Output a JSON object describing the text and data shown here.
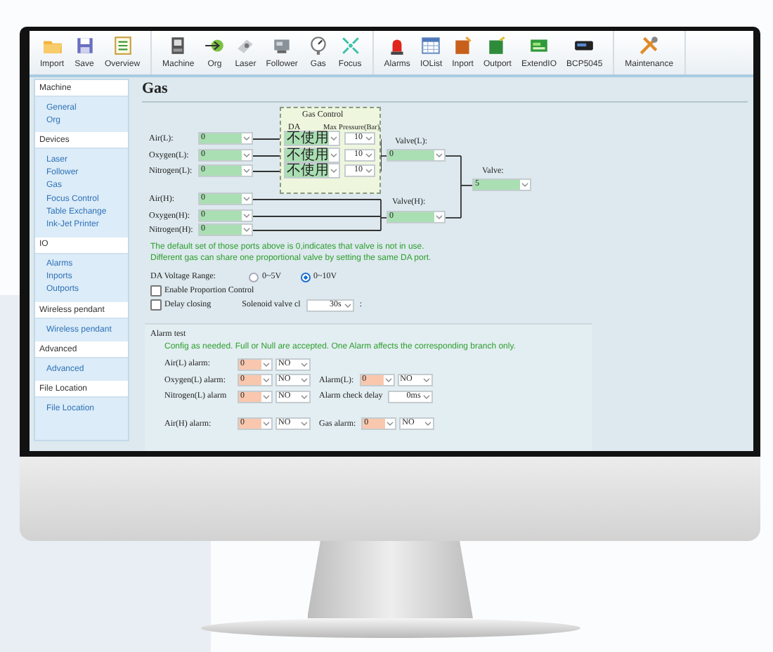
{
  "toolbar": {
    "groups": [
      [
        {
          "label": "Import",
          "kind": "folder"
        },
        {
          "label": "Save",
          "kind": "disk"
        },
        {
          "label": "Overview",
          "kind": "list"
        }
      ],
      [
        {
          "label": "Machine",
          "kind": "machine"
        },
        {
          "label": "Org",
          "kind": "origin"
        },
        {
          "label": "Laser",
          "kind": "laser"
        },
        {
          "label": "Follower",
          "kind": "follower"
        },
        {
          "label": "Gas",
          "kind": "gauge"
        },
        {
          "label": "Focus",
          "kind": "focus"
        }
      ],
      [
        {
          "label": "Alarms",
          "kind": "alarm"
        },
        {
          "label": "IOList",
          "kind": "table"
        },
        {
          "label": "Inport",
          "kind": "inport"
        },
        {
          "label": "Outport",
          "kind": "outport"
        },
        {
          "label": "ExtendIO",
          "kind": "board"
        },
        {
          "label": "BCP5045",
          "kind": "display"
        }
      ],
      [
        {
          "label": "Maintenance",
          "kind": "tools"
        }
      ]
    ]
  },
  "sidebar": {
    "groups": [
      {
        "title": "Machine",
        "items": [
          "General",
          "Org"
        ]
      },
      {
        "title": "Devices",
        "items": [
          "Laser",
          "Follower",
          "Gas",
          "Focus Control",
          "Table Exchange",
          "Ink-Jet Printer"
        ]
      },
      {
        "title": "IO",
        "items": [
          "Alarms",
          "Inports",
          "Outports"
        ]
      },
      {
        "title": "Wireless pendant",
        "items": [
          "Wireless pendant"
        ]
      },
      {
        "title": "Advanced",
        "items": [
          "Advanced"
        ]
      },
      {
        "title": "File Location",
        "items": [
          "File Location"
        ]
      }
    ]
  },
  "page": {
    "title": "Gas",
    "gas_control": {
      "title": "Gas Control",
      "da_header": "DA",
      "pressure_header": "Max Pressure(Bar)"
    },
    "low_gases": [
      {
        "label": "Air(L):",
        "port": "0",
        "da": "不使用",
        "pressure": "10"
      },
      {
        "label": "Oxygen(L):",
        "port": "0",
        "da": "不使用",
        "pressure": "10"
      },
      {
        "label": "Nitrogen(L):",
        "port": "0",
        "da": "不使用",
        "pressure": "10"
      }
    ],
    "high_gases": [
      {
        "label": "Air(H):",
        "port": "0"
      },
      {
        "label": "Oxygen(H):",
        "port": "0"
      },
      {
        "label": "Nitrogen(H):",
        "port": "0"
      }
    ],
    "valve_low": {
      "label": "Valve(L):",
      "value": "0"
    },
    "valve_high": {
      "label": "Valve(H):",
      "value": "0"
    },
    "valve": {
      "label": "Valve:",
      "value": "5"
    },
    "notes": [
      "The default set of those ports above is 0,indicates that valve is not in use.",
      "Different gas can share one proportional valve by setting the same DA port."
    ],
    "voltage": {
      "label": "DA Voltage Range:",
      "options": [
        {
          "label": "0~5V",
          "selected": false
        },
        {
          "label": "0~10V",
          "selected": true
        }
      ]
    },
    "checkboxes": [
      {
        "label": "Enable Proportion Control",
        "checked": false
      },
      {
        "label": "Delay closing",
        "checked": false
      }
    ],
    "solenoid": {
      "label": "Solenoid valve cl",
      "value": "30s",
      "suffix": ":"
    },
    "alarm_test": {
      "title": "Alarm test",
      "note": "Config as needed. Full or Null are accepted. One Alarm affects the corresponding branch only.",
      "groups": [
        [
          {
            "label": "Air(L) alarm:",
            "port": "0",
            "state": "NO"
          },
          {
            "label": "Oxygen(L) alarm:",
            "port": "0",
            "state": "NO",
            "extra": {
              "kind": "branch",
              "label": "Alarm(L):",
              "port": "0",
              "state": "NO"
            }
          },
          {
            "label": "Nitrogen(L) alarm",
            "port": "0",
            "state": "NO",
            "extra": {
              "kind": "delay",
              "label": "Alarm check delay",
              "value": "0ms"
            }
          }
        ],
        [
          {
            "label": "Air(H) alarm:",
            "port": "0",
            "state": "NO",
            "extra": {
              "kind": "main",
              "label": "Gas alarm:",
              "port": "0",
              "state": "NO"
            }
          }
        ]
      ]
    }
  }
}
